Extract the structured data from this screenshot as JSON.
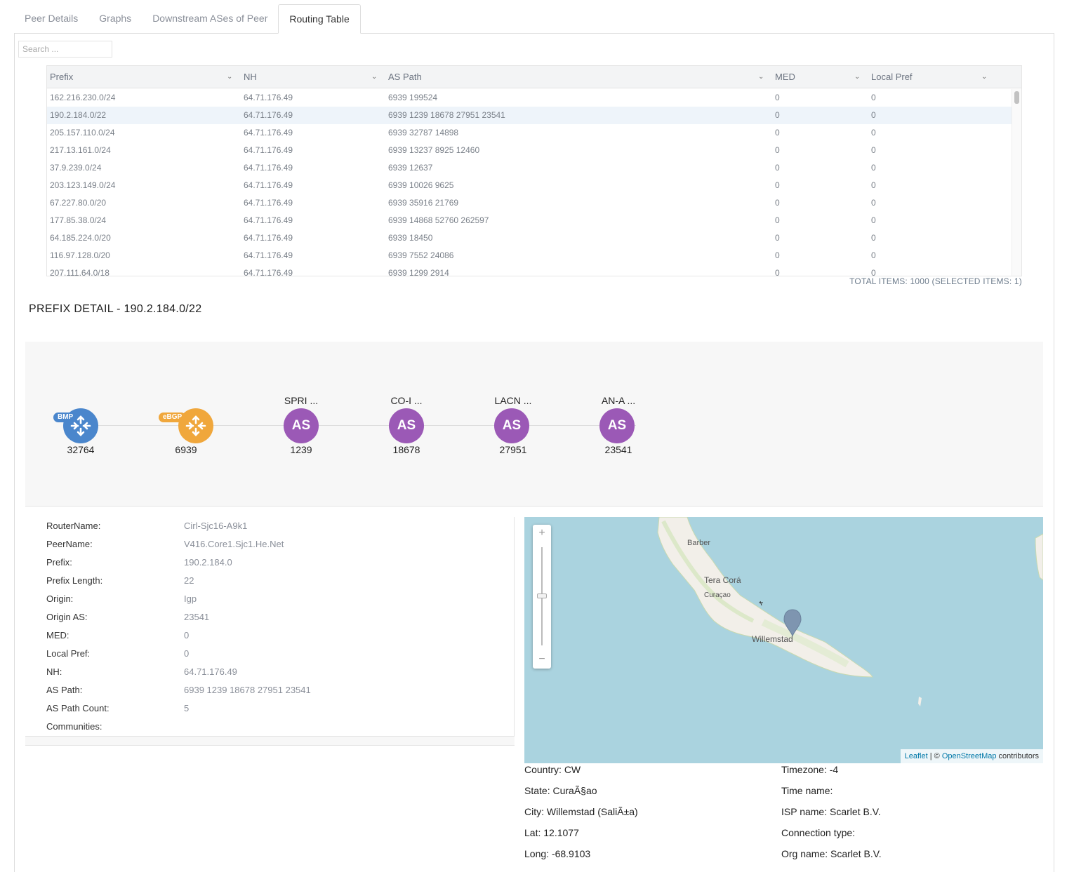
{
  "tabs": [
    {
      "label": "Peer Details"
    },
    {
      "label": "Graphs"
    },
    {
      "label": "Downstream ASes of Peer"
    },
    {
      "label": "Routing Table"
    }
  ],
  "search": {
    "placeholder": "Search ..."
  },
  "table": {
    "columns": [
      {
        "label": "Prefix"
      },
      {
        "label": "NH"
      },
      {
        "label": "AS Path"
      },
      {
        "label": "MED"
      },
      {
        "label": "Local Pref"
      }
    ],
    "rows": [
      {
        "prefix": "162.216.230.0/24",
        "nh": "64.71.176.49",
        "as_path": "6939 199524",
        "med": "0",
        "local_pref": "0"
      },
      {
        "prefix": "190.2.184.0/22",
        "nh": "64.71.176.49",
        "as_path": "6939 1239 18678 27951 23541",
        "med": "0",
        "local_pref": "0"
      },
      {
        "prefix": "205.157.110.0/24",
        "nh": "64.71.176.49",
        "as_path": "6939 32787 14898",
        "med": "0",
        "local_pref": "0"
      },
      {
        "prefix": "217.13.161.0/24",
        "nh": "64.71.176.49",
        "as_path": "6939 13237 8925 12460",
        "med": "0",
        "local_pref": "0"
      },
      {
        "prefix": "37.9.239.0/24",
        "nh": "64.71.176.49",
        "as_path": "6939 12637",
        "med": "0",
        "local_pref": "0"
      },
      {
        "prefix": "203.123.149.0/24",
        "nh": "64.71.176.49",
        "as_path": "6939 10026 9625",
        "med": "0",
        "local_pref": "0"
      },
      {
        "prefix": "67.227.80.0/20",
        "nh": "64.71.176.49",
        "as_path": "6939 35916 21769",
        "med": "0",
        "local_pref": "0"
      },
      {
        "prefix": "177.85.38.0/24",
        "nh": "64.71.176.49",
        "as_path": "6939 14868 52760 262597",
        "med": "0",
        "local_pref": "0"
      },
      {
        "prefix": "64.185.224.0/20",
        "nh": "64.71.176.49",
        "as_path": "6939 18450",
        "med": "0",
        "local_pref": "0"
      },
      {
        "prefix": "116.97.128.0/20",
        "nh": "64.71.176.49",
        "as_path": "6939 7552 24086",
        "med": "0",
        "local_pref": "0"
      },
      {
        "prefix": "207.111.64.0/18",
        "nh": "64.71.176.49",
        "as_path": "6939 1299 2914",
        "med": "0",
        "local_pref": "0"
      }
    ],
    "total": "TOTAL ITEMS: 1000 (SELECTED ITEMS: 1)"
  },
  "detail": {
    "title": "PREFIX DETAIL - 190.2.184.0/22"
  },
  "path": {
    "nodes": [
      {
        "type": "bmp",
        "badge": "BMP",
        "asn": "32764"
      },
      {
        "type": "ebgp",
        "badge": "eBGP",
        "asn": "6939"
      },
      {
        "type": "as",
        "name": "SPRI ...",
        "text": "AS",
        "asn": "1239"
      },
      {
        "type": "as",
        "name": "CO-I ...",
        "text": "AS",
        "asn": "18678"
      },
      {
        "type": "as",
        "name": "LACN ...",
        "text": "AS",
        "asn": "27951"
      },
      {
        "type": "as",
        "name": "AN-A ...",
        "text": "AS",
        "asn": "23541"
      }
    ],
    "colors": {
      "bmp": "#4a86cc",
      "ebgp": "#f0a73c",
      "as": "#9b59b6"
    }
  },
  "info": [
    {
      "key": "RouterName:",
      "value": "Cirl-Sjc16-A9k1"
    },
    {
      "key": "PeerName:",
      "value": "V416.Core1.Sjc1.He.Net"
    },
    {
      "key": "Prefix:",
      "value": "190.2.184.0"
    },
    {
      "key": "Prefix Length:",
      "value": "22"
    },
    {
      "key": "Origin:",
      "value": "Igp"
    },
    {
      "key": "Origin AS:",
      "value": "23541"
    },
    {
      "key": "MED:",
      "value": "0"
    },
    {
      "key": "Local Pref:",
      "value": "0"
    },
    {
      "key": "NH:",
      "value": "64.71.176.49"
    },
    {
      "key": "AS Path:",
      "value": " 6939 1239 18678 27951 23541"
    },
    {
      "key": "AS Path Count:",
      "value": "5"
    },
    {
      "key": "Communities:",
      "value": ""
    }
  ],
  "map": {
    "zoom_in": "+",
    "zoom_out": "−",
    "labels": {
      "barber": "Barber",
      "tera_cora": "Tera Corá",
      "curacao": "Curaçao",
      "willemstad": "Willemstad"
    },
    "attribution": {
      "leaflet": "Leaflet",
      "sep": " | © ",
      "osm": "OpenStreetMap",
      "suffix": " contributors"
    }
  },
  "geo": {
    "left": [
      {
        "label": "Country:",
        "value": "CW"
      },
      {
        "label": "State:",
        "value": "CuraÃ§ao"
      },
      {
        "label": "City:",
        "value": "Willemstad (SaliÃ±a)"
      },
      {
        "label": "Lat:",
        "value": "12.1077"
      },
      {
        "label": "Long:",
        "value": "-68.9103"
      }
    ],
    "right": [
      {
        "label": "Timezone:",
        "value": "-4"
      },
      {
        "label": "Time name:",
        "value": ""
      },
      {
        "label": "ISP name:",
        "value": "Scarlet B.V."
      },
      {
        "label": "Connection type:",
        "value": ""
      },
      {
        "label": "Org name:",
        "value": "Scarlet B.V."
      }
    ]
  }
}
